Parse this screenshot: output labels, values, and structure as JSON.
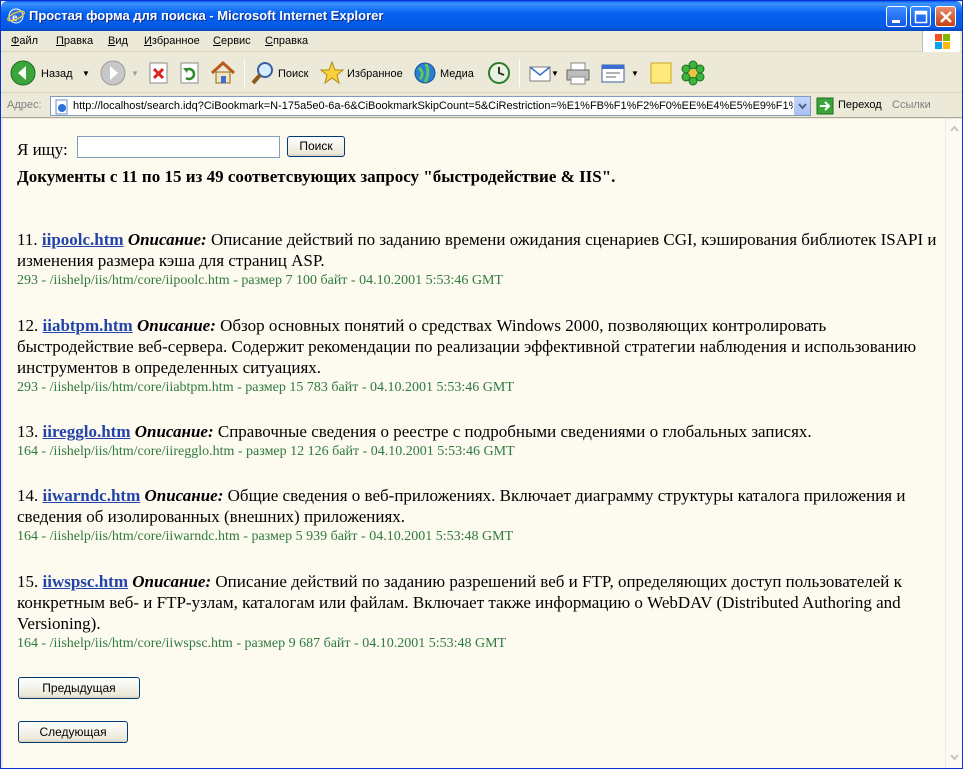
{
  "window": {
    "title": "Простая форма для поиска - Microsoft Internet Explorer"
  },
  "menu": [
    "Файл",
    "Правка",
    "Вид",
    "Избранное",
    "Сервис",
    "Справка"
  ],
  "toolbar": {
    "back": "Назад",
    "search": "Поиск",
    "favorites": "Избранное",
    "media": "Медиа"
  },
  "address": {
    "label": "Адрес:",
    "url": "http://localhost/search.idq?CiBookmark=N-175a5e0-6a-6&CiBookmarkSkipCount=5&CiRestriction=%E1%FB%F1%F2%F0%EE%E4%E5%E9%F1%F",
    "go": "Переход",
    "links": "Ссылки"
  },
  "search": {
    "label": "Я ищу:",
    "value": "",
    "button": "Поиск"
  },
  "summary": "Документы с 11 по 15 из 49 соответсвующих запросу \"быстродействие & IIS\".",
  "description_label": "Описание:",
  "results": [
    {
      "num": "11.",
      "file": "iipoolc.htm",
      "desc": "Описание действий по заданию времени ожидания сценариев CGI, кэширования библиотек ISAPI и изменения размера кэша для страниц ASP.",
      "meta": "293 - /iishelp/iis/htm/core/iipoolc.htm - размер 7 100 байт - 04.10.2001 5:53:46 GMT"
    },
    {
      "num": "12.",
      "file": "iiabtpm.htm",
      "desc": "Обзор основных понятий о средствах Windows 2000, позволяющих контролировать быстродействие веб-сервера. Содержит рекомендации по реализации эффективной стратегии наблюдения и использованию инструментов в определенных ситуациях.",
      "meta": "293 - /iishelp/iis/htm/core/iiabtpm.htm - размер 15 783 байт - 04.10.2001 5:53:46 GMT"
    },
    {
      "num": "13.",
      "file": "iiregglo.htm",
      "desc": "Справочные сведения о реестре с подробными сведениями о глобальных записях.",
      "meta": "164 - /iishelp/iis/htm/core/iiregglo.htm - размер 12 126 байт - 04.10.2001 5:53:46 GMT"
    },
    {
      "num": "14.",
      "file": "iiwarndc.htm",
      "desc": "Общие сведения о веб-приложениях. Включает диаграмму структуры каталога приложения и сведения об изолированных (внешних) приложениях.",
      "meta": "164 - /iishelp/iis/htm/core/iiwarndc.htm - размер 5 939 байт - 04.10.2001 5:53:48 GMT"
    },
    {
      "num": "15.",
      "file": "iiwspsc.htm",
      "desc": "Описание действий по заданию разрешений веб и FTP, определяющих доступ пользователей к конкретным веб- и FTP-узлам, каталогам или файлам. Включает также информацию о WebDAV (Distributed Authoring and Versioning).",
      "meta": "164 - /iishelp/iis/htm/core/iiwspsc.htm - размер 9 687 байт - 04.10.2001 5:53:48 GMT"
    }
  ],
  "pager": {
    "prev": "Предыдущая",
    "next": "Следующая"
  },
  "colors": {
    "link": "#2244aa",
    "meta": "#2f7a3f",
    "page_bg": "#fdfaf0",
    "titlebar": "#0559e4"
  },
  "icons": [
    "ie-icon",
    "back-icon",
    "forward-icon",
    "stop-icon",
    "refresh-icon",
    "home-icon",
    "search-icon",
    "favorites-icon",
    "media-icon",
    "history-icon",
    "mail-icon",
    "print-icon",
    "edit-icon",
    "note-icon",
    "messenger-icon",
    "go-icon",
    "windows-logo-icon"
  ]
}
